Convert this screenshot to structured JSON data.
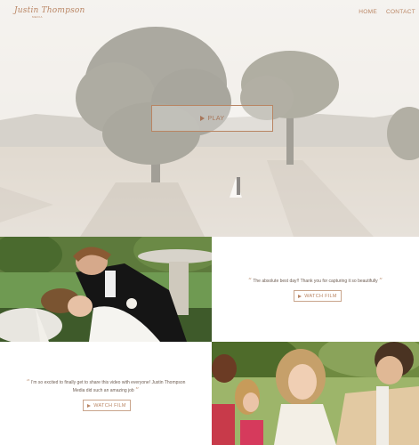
{
  "nav": {
    "logo": "Justin Thompson",
    "logo_sub": "MEDIA",
    "links": [
      "HOME",
      "CONTACT"
    ]
  },
  "hero": {
    "play_label": "PLAY"
  },
  "testimonials": [
    {
      "quote": "The absolute best day!! Thank you for capturing it so beautifully",
      "button": "WATCH FILM"
    },
    {
      "quote_line1": "I'm so excited to finally get to share this video with everyone! Justin Thompson",
      "quote_line2": "Media did such an amazing job",
      "button": "WATCH FILM"
    }
  ],
  "colors": {
    "accent": "#b98563",
    "text": "#6e5d52"
  }
}
